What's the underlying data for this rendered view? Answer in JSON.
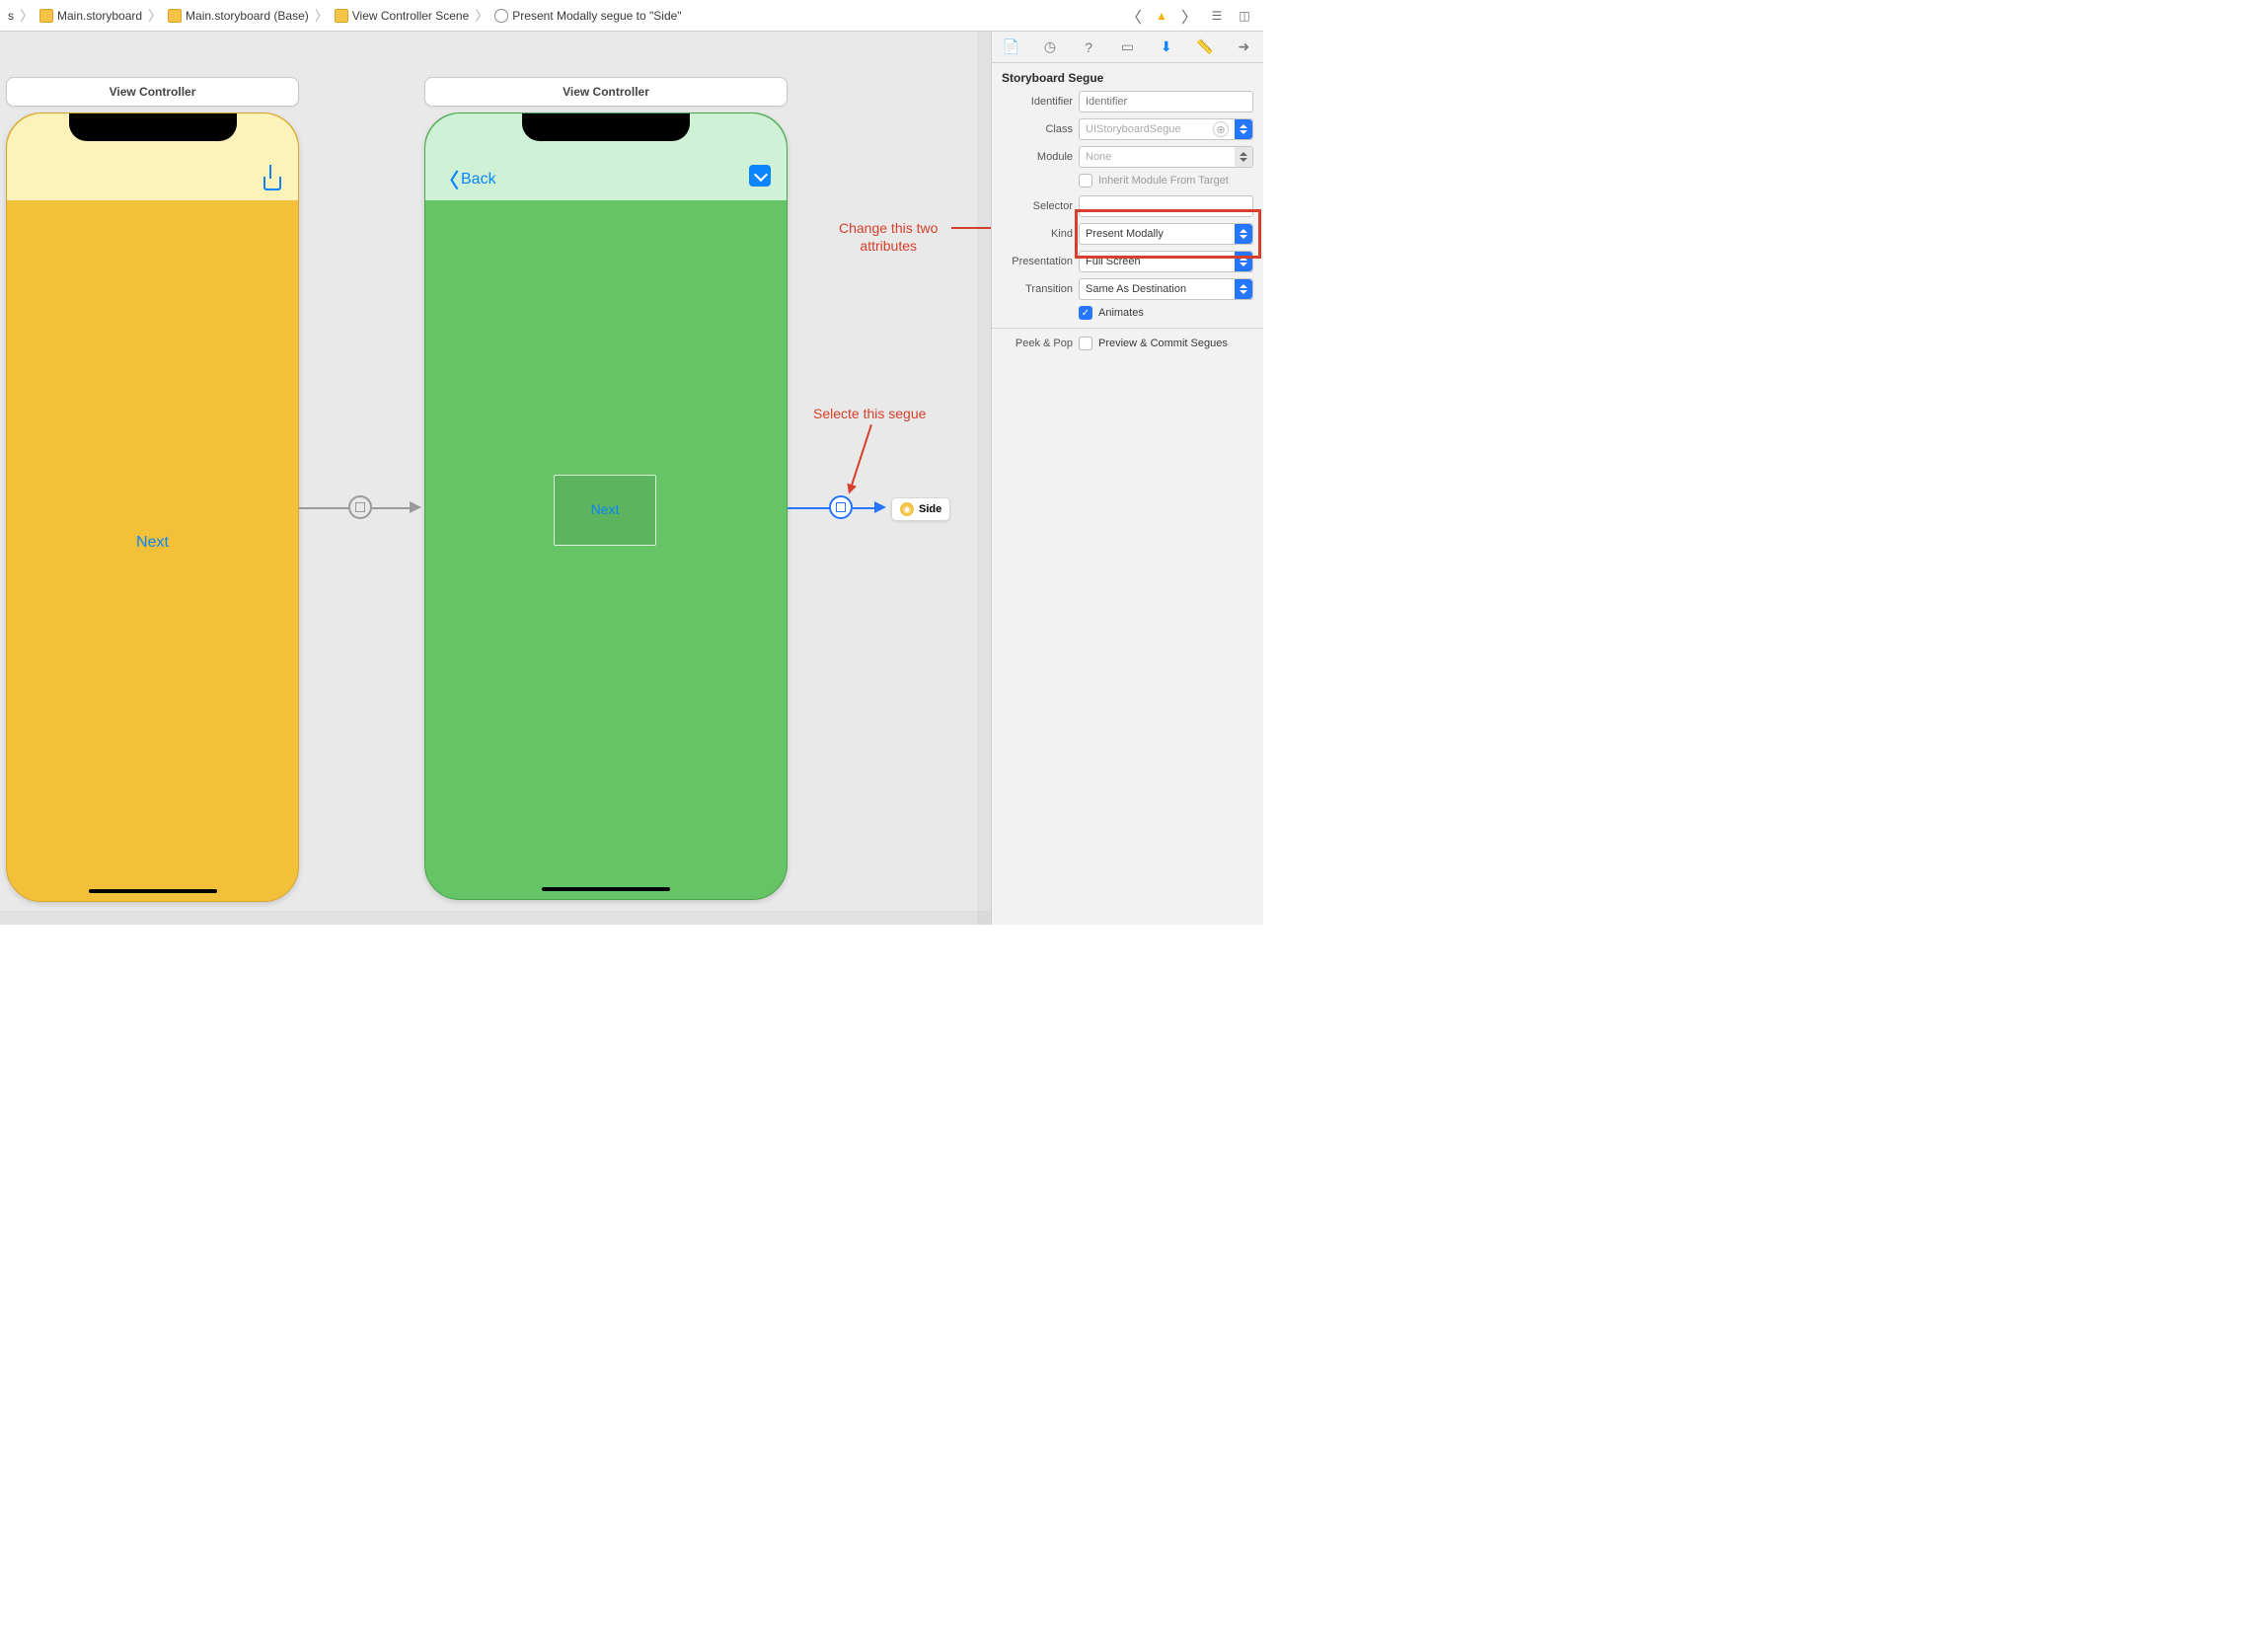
{
  "breadcrumbs": {
    "b0_suffix": "s",
    "b1": "Main.storyboard",
    "b2": "Main.storyboard (Base)",
    "b3": "View Controller Scene",
    "b4": "Present Modally segue to \"Side\""
  },
  "scene1": {
    "title": "View Controller",
    "button": "Next"
  },
  "scene2": {
    "title": "View Controller",
    "back": "Back",
    "button": "Next"
  },
  "side_chip": "Side",
  "annotations": {
    "attrs": "Change this two\nattributes",
    "segue": "Selecte this segue"
  },
  "inspector": {
    "section": "Storyboard Segue",
    "labels": {
      "identifier": "Identifier",
      "class": "Class",
      "module": "Module",
      "inherit": "Inherit Module From Target",
      "selector": "Selector",
      "kind": "Kind",
      "presentation": "Presentation",
      "transition": "Transition",
      "animates": "Animates",
      "peek": "Peek & Pop",
      "preview": "Preview & Commit Segues"
    },
    "values": {
      "identifier_ph": "Identifier",
      "class_ph": "UIStoryboardSegue",
      "module_ph": "None",
      "selector": "",
      "kind": "Present Modally",
      "presentation": "Full Screen",
      "transition": "Same As Destination"
    }
  }
}
